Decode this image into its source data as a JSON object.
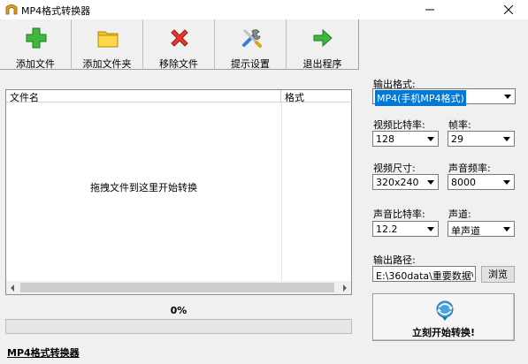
{
  "window": {
    "title": "MP4格式转换器"
  },
  "toolbar": {
    "add_file": "添加文件",
    "add_folder": "添加文件夹",
    "remove_file": "移除文件",
    "prompt_settings": "提示设置",
    "exit": "退出程序"
  },
  "file_list": {
    "columns": [
      "文件名",
      "格式"
    ],
    "drop_hint": "拖拽文件到这里开始转换"
  },
  "progress": {
    "text": "0%",
    "value": 0
  },
  "status": {
    "app_name": "MP4格式转换器"
  },
  "settings": {
    "output_format_label": "输出格式:",
    "output_format_value": "MP4(手机MP4格式)",
    "video_bitrate_label": "视频比特率:",
    "video_bitrate_value": "128",
    "frame_rate_label": "帧率:",
    "frame_rate_value": "29",
    "video_size_label": "视频尺寸:",
    "video_size_value": "320x240",
    "audio_freq_label": "声音频率:",
    "audio_freq_value": "8000",
    "audio_bitrate_label": "声音比特率:",
    "audio_bitrate_value": "12.2",
    "channel_label": "声道:",
    "channel_value": "单声道",
    "output_path_label": "输出路径:",
    "output_path_value": "E:\\360data\\重要数据\\桌",
    "browse_label": "浏览",
    "start_label": "立刻开始转换!"
  },
  "colors": {
    "selection": "#0078d7",
    "progress": "#06b025"
  }
}
